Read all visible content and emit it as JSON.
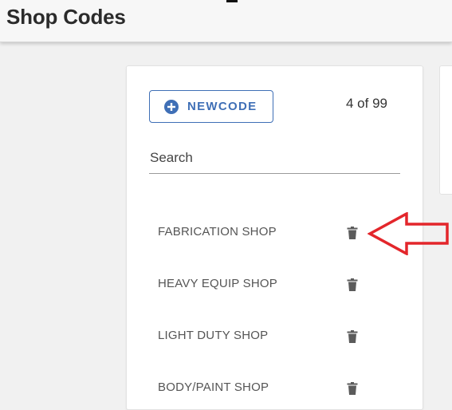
{
  "header": {
    "title": "Shop Codes"
  },
  "toolbar": {
    "new_label": "NEWCODE",
    "count": "4 of 99"
  },
  "search": {
    "label": "Search"
  },
  "list": {
    "items": [
      {
        "label": "FABRICATION SHOP"
      },
      {
        "label": "HEAVY EQUIP SHOP"
      },
      {
        "label": "LIGHT DUTY SHOP"
      },
      {
        "label": "BODY/PAINT SHOP"
      }
    ]
  },
  "colors": {
    "accent": "#3f6fb6",
    "annotation": "#e3262b"
  },
  "icons": [
    "plus-circle-icon",
    "trash-icon",
    "arrow-left-icon"
  ]
}
